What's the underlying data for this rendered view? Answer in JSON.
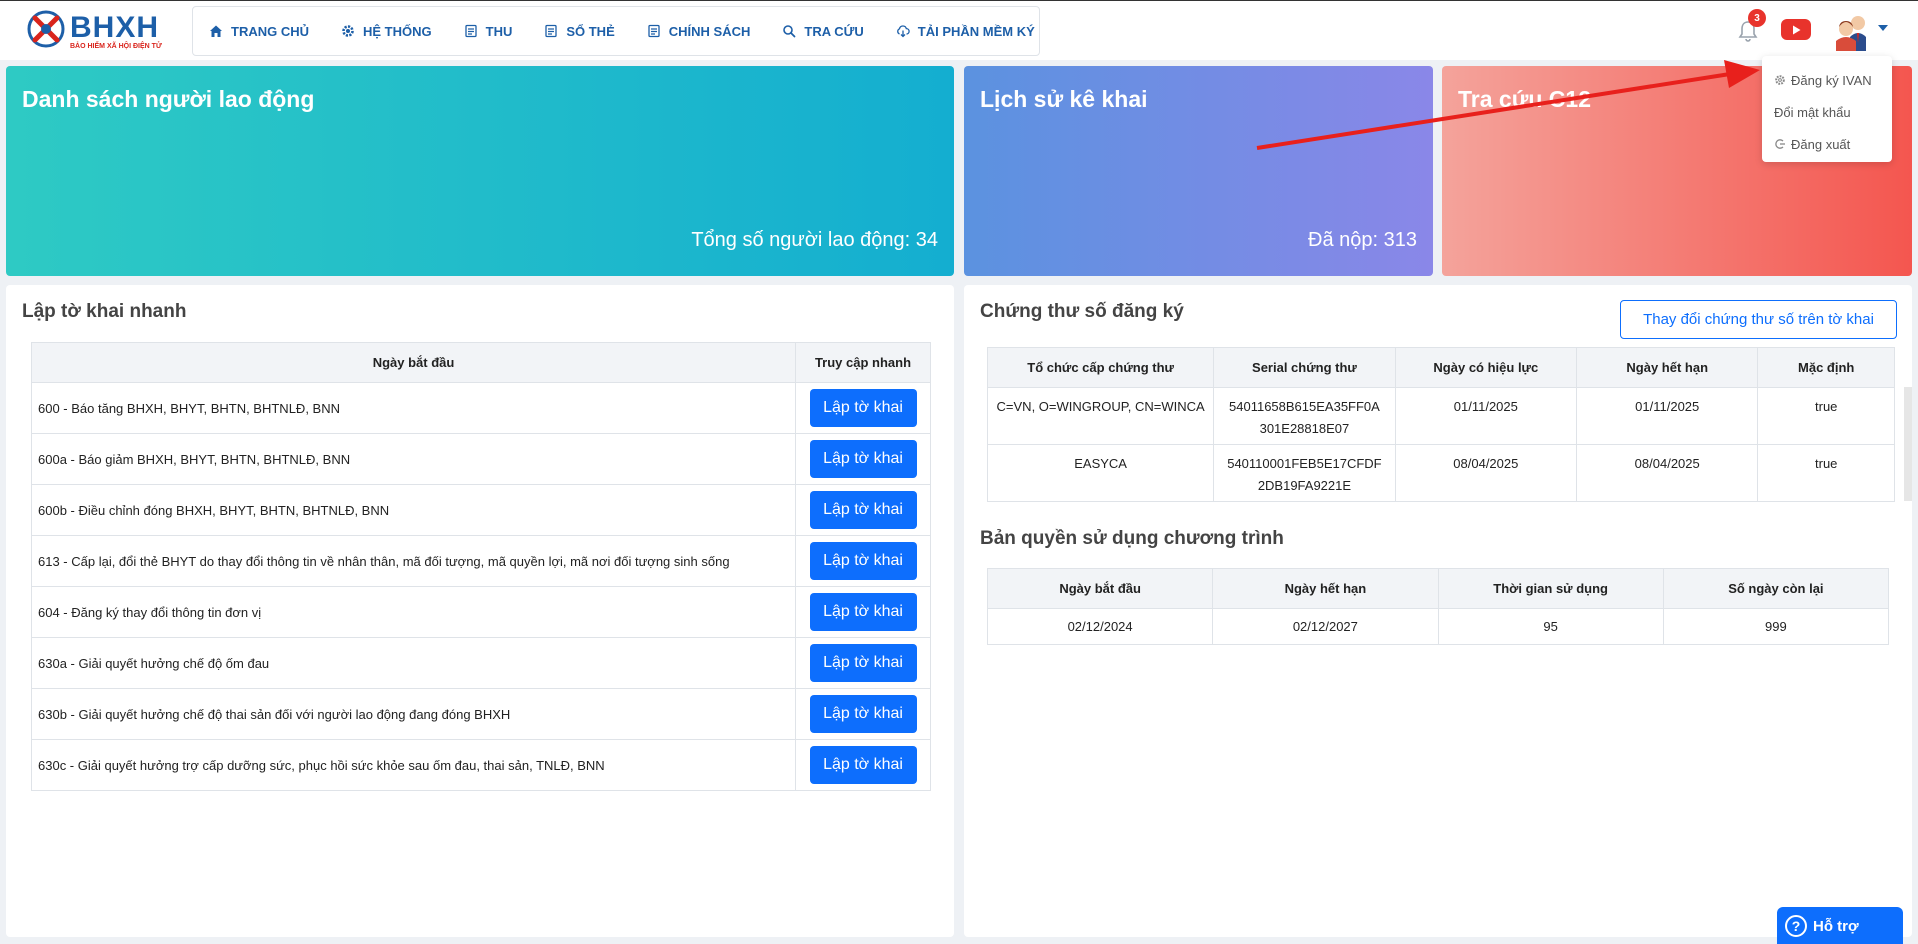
{
  "header": {
    "logo_text": "BHXH",
    "logo_sub": "BẢO HIỂM XÃ HỘI ĐIỆN TỬ",
    "nav": [
      {
        "label": "TRANG CHỦ",
        "icon": "home-icon"
      },
      {
        "label": "HỆ THỐNG",
        "icon": "gear-icon"
      },
      {
        "label": "THU",
        "icon": "document-icon"
      },
      {
        "label": "SỔ THẺ",
        "icon": "document-icon"
      },
      {
        "label": "CHÍNH SÁCH",
        "icon": "document-icon"
      },
      {
        "label": "TRA CỨU",
        "icon": "search-icon"
      },
      {
        "label": "TẢI PHẦN MỀM KÝ",
        "icon": "cloud-download-icon"
      }
    ],
    "notification_count": "3",
    "user_menu": [
      {
        "label": "Đăng ký IVAN",
        "icon": "gear-icon"
      },
      {
        "label": "Đổi mật khẩu",
        "icon": ""
      },
      {
        "label": "Đăng xuất",
        "icon": "logout-icon"
      }
    ]
  },
  "cards": {
    "workers": {
      "title": "Danh sách người lao động",
      "value": "Tổng số người lao động: 34"
    },
    "history": {
      "title": "Lịch sử kê khai",
      "value": "Đã nộp: 313"
    },
    "lookup": {
      "title": "Tra cứu C12"
    }
  },
  "quick": {
    "title": "Lập tờ khai nhanh",
    "col_start": "Ngày bắt đầu",
    "col_access": "Truy cập nhanh",
    "button_label": "Lập tờ khai",
    "rows": [
      "600 - Báo tăng BHXH, BHYT, BHTN, BHTNLĐ, BNN",
      "600a - Báo giảm BHXH, BHYT, BHTN, BHTNLĐ, BNN",
      "600b - Điều chỉnh đóng BHXH, BHYT, BHTN, BHTNLĐ, BNN",
      "613 - Cấp lại, đổi thẻ BHYT do thay đổi thông tin về nhân thân, mã đối tượng, mã quyền lợi, mã nơi đối tượng sinh sống",
      "604 - Đăng ký thay đổi thông tin đơn vị",
      "630a - Giải quyết hưởng chế độ ốm đau",
      "630b - Giải quyết hưởng chế độ thai sản đối với người lao động đang đóng BHXH",
      "630c - Giải quyết hưởng trợ cấp dưỡng sức, phục hồi sức khỏe sau ốm đau, thai sản, TNLĐ, BNN"
    ]
  },
  "certs": {
    "title": "Chứng thư số đăng ký",
    "change_button": "Thay đổi chứng thư số trên tờ khai",
    "columns": [
      "Tổ chức cấp chứng thư",
      "Serial chứng thư",
      "Ngày có hiệu lực",
      "Ngày hết hạn",
      "Mặc định"
    ],
    "rows": [
      {
        "issuer": "C=VN, O=WINGROUP, CN=WINCA",
        "serial1": "54011658B615EA35FF0A",
        "serial2": "301E28818E07",
        "valid_from": "01/11/2025",
        "valid_to": "01/11/2025",
        "default": "true"
      },
      {
        "issuer": "EASYCA",
        "serial1": "540110001FEB5E17CFDF",
        "serial2": "2DB19FA9221E",
        "valid_from": "08/04/2025",
        "valid_to": "08/04/2025",
        "default": "true"
      }
    ]
  },
  "license": {
    "title": "Bản quyền sử dụng chương trình",
    "columns": [
      "Ngày bắt đầu",
      "Ngày hết hạn",
      "Thời gian sử dụng",
      "Số ngày còn lại"
    ],
    "row": [
      "02/12/2024",
      "02/12/2027",
      "95",
      "999"
    ]
  },
  "help_button": "Hỗ trợ",
  "colors": {
    "primary": "#0d6efd",
    "brand": "#1d5fa8",
    "accent_red": "#e8332c"
  }
}
